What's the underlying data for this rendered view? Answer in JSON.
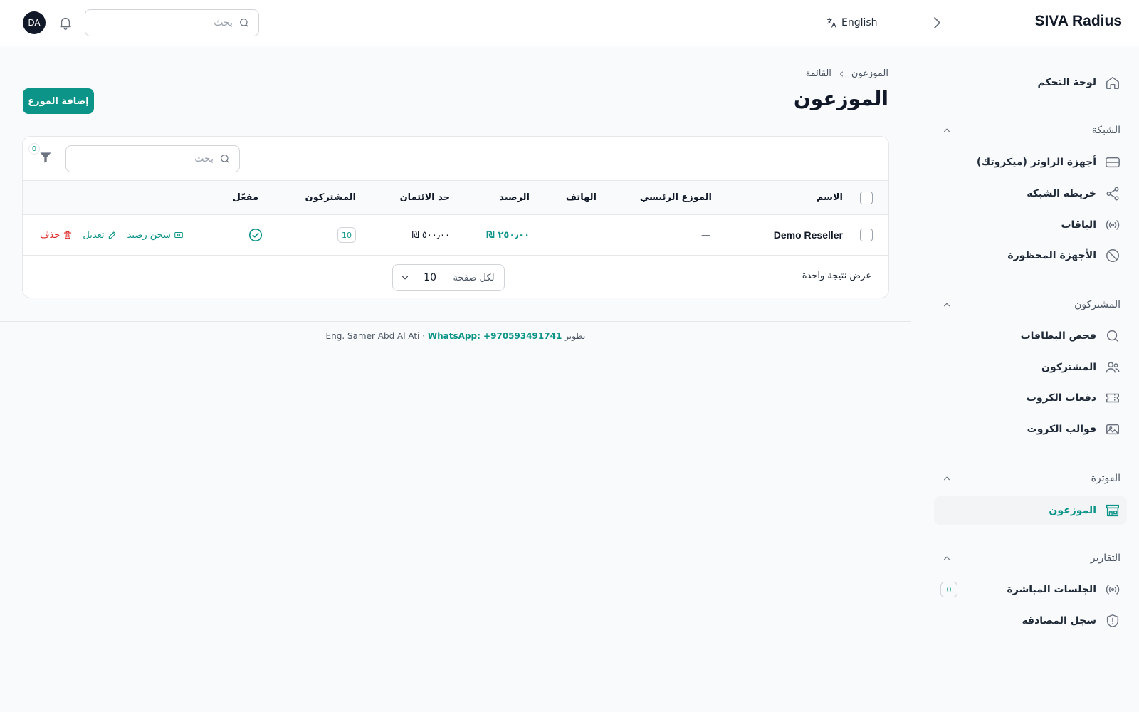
{
  "header": {
    "brand": "SIVA Radius",
    "language": "English",
    "search_placeholder": "بحث",
    "avatar_initials": "DA"
  },
  "sidebar": {
    "dashboard": "لوحة التحكم",
    "sections": {
      "network": "الشبكة",
      "subscribers": "المشتركون",
      "billing": "الفوترة",
      "reports": "التقارير"
    },
    "items": {
      "routers": "أجهزة الراوتر (ميكروتك)",
      "network_map": "خريطة الشبكة",
      "packages": "الباقات",
      "blocked_devices": "الأجهزة المحظورة",
      "card_check": "فحص البطاقات",
      "subscribers": "المشتركون",
      "card_batches": "دفعات الكروت",
      "card_templates": "قوالب الكروت",
      "resellers": "الموزعون",
      "live_sessions": "الجلسات المباشرة",
      "live_sessions_count": "0",
      "auth_log": "سجل المصادقة"
    },
    "active_item": "resellers"
  },
  "main": {
    "breadcrumb": [
      "الموزعون",
      "القائمة"
    ],
    "title": "الموزعون",
    "add_button": "إضافة الموزع",
    "table": {
      "search_placeholder": "بحث",
      "filter_count": "0",
      "columns": {
        "name": "الاسم",
        "parent": "الموزع الرئيسي",
        "phone": "الهاتف",
        "balance": "الرصيد",
        "credit_limit": "حد الائتمان",
        "subscribers": "المشتركون",
        "locked": "مفعّل"
      },
      "rows": [
        {
          "name": "Demo Reseller",
          "parent": "—",
          "phone": "",
          "balance": "₪ ٢٥٠٫٠٠",
          "credit_limit": "₪ ٥٠٠٫٠٠",
          "subscribers": "10",
          "active": true
        }
      ],
      "actions": {
        "top_up": "شحن رصيد",
        "edit": "تعديل",
        "delete": "حذف"
      },
      "result_text": "عرض نتيجة واحدة",
      "per_page_label": "لكل صفحة",
      "per_page_value": "10"
    }
  },
  "footer": {
    "developer": "تطوير Eng. Samer Abd Al Ati ·",
    "whatsapp": "WhatsApp: +970593491741"
  },
  "colors": {
    "accent": "#0d9488",
    "danger": "#dc2626"
  }
}
